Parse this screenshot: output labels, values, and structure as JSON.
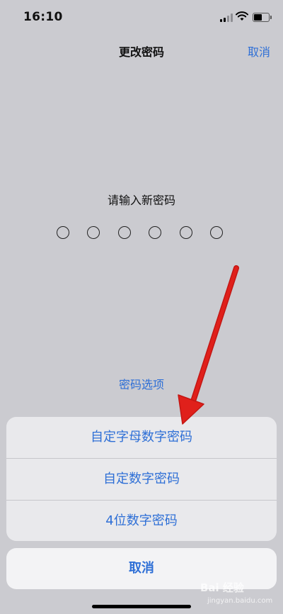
{
  "status": {
    "time": "16:10"
  },
  "nav": {
    "title": "更改密码",
    "cancel": "取消"
  },
  "passcode": {
    "prompt": "请输入新密码",
    "digit_count": 6,
    "entered": 0
  },
  "options_link": "密码选项",
  "action_sheet": {
    "items": [
      {
        "label": "自定字母数字密码"
      },
      {
        "label": "自定数字密码"
      },
      {
        "label": "4位数字密码"
      }
    ],
    "cancel": "取消"
  },
  "watermark": {
    "text": "Bai 经验",
    "sub": "jingyan.baidu.com"
  },
  "colors": {
    "accent": "#2e6fd6",
    "annotation_arrow": "#e0201b",
    "background": "#cbcbd0"
  }
}
